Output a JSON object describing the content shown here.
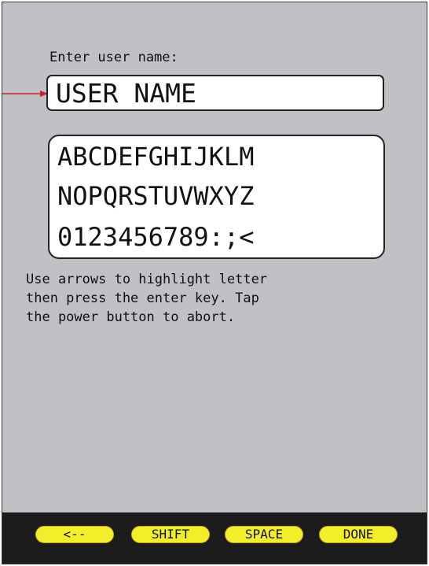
{
  "prompt": "Enter user name:",
  "user_name_value": "USER NAME",
  "keyboard": {
    "rows": [
      "ABCDEFGHIJKLM",
      "NOPQRSTUVWXYZ",
      "0123456789:;<"
    ]
  },
  "instructions": "Use arrows to highlight letter\nthen press the enter key. Tap\nthe power button to abort.",
  "softkeys": {
    "back": "<--",
    "shift": "SHIFT",
    "space": "SPACE",
    "done": "DONE"
  },
  "colors": {
    "screen_bg": "#c0c1c5",
    "softkey_bg": "#f2ef2a",
    "softkey_bar": "#1c1c1c",
    "callout_arrow": "#d0202a"
  }
}
